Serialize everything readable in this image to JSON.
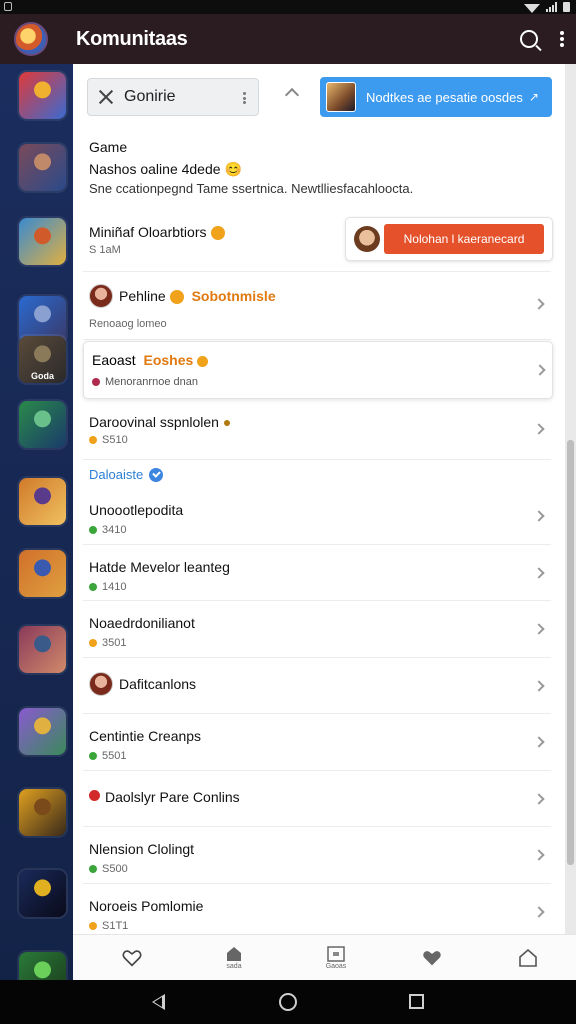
{
  "app": {
    "title": "Komunitaas"
  },
  "search": {
    "value": "Gonirie"
  },
  "promo": {
    "label": "Nodtkes ae pesatie oosdes",
    "arrow": "↗"
  },
  "intro": {
    "heading": "Game",
    "subheading": "Nashos oaline 4dede",
    "subheading_emoji": "😊",
    "description": "Sne ccationpegnd Tame ssertnica. Newtlliesfacahloocta."
  },
  "featured": {
    "title": "Miniñaf Oloarbtiors",
    "meta": "S 1aM",
    "button_label": "Nolohan l kaeranecard"
  },
  "rows": [
    {
      "title": "Pehline",
      "title_highlight": "Sobotnmisle",
      "meta": "Renoaog lomeo",
      "has_avatar": true
    },
    {
      "title": "Eaoast",
      "title_highlight": "Eoshes",
      "meta": "Menoranrnoe dnan",
      "card": true
    },
    {
      "title": "Daroovinal sspnlolen",
      "meta": "S510"
    }
  ],
  "section": {
    "label": "Daloaiste"
  },
  "list": [
    {
      "title": "Unoootlepodita",
      "meta": "3410",
      "dot_color": "#3aa63a"
    },
    {
      "title": "Hatde Mevelor leanteg",
      "meta": "1410",
      "dot_color": "#3aa63a"
    },
    {
      "title": "Noaedrdonilianot",
      "meta": "3501",
      "dot_color": "#f0a21a"
    },
    {
      "title": "Dafitcanlons",
      "meta": "",
      "has_avatar": true
    },
    {
      "title": "Centintie Creanps",
      "meta": "5501",
      "dot_color": "#3aa63a"
    },
    {
      "title": "Daolslyr Pare Conlins",
      "meta": "",
      "lead_dot": "#d22a2a"
    },
    {
      "title": "Nlension Clolingt",
      "meta": "S500",
      "dot_color": "#3aa63a"
    },
    {
      "title": "Noroeis Pomlomie",
      "meta": "S1T1",
      "dot_color": "#f0a21a"
    }
  ],
  "bottom_nav": [
    {
      "icon": "heart-outline-icon",
      "label": ""
    },
    {
      "icon": "shop-icon",
      "label": "sada"
    },
    {
      "icon": "gallery-icon",
      "label": "Gaoas"
    },
    {
      "icon": "heart-filled-icon",
      "label": ""
    },
    {
      "icon": "home-icon",
      "label": ""
    }
  ],
  "rail": [
    {
      "icon": "game-icon-1",
      "colors": [
        "#e03a3a",
        "#f0b030",
        "#3a6ad0"
      ]
    },
    {
      "icon": "game-icon-2",
      "colors": [
        "#7a4a5a",
        "#c08a6a",
        "#2a4a8a"
      ]
    },
    {
      "icon": "game-icon-3",
      "colors": [
        "#3a8ad0",
        "#d05a2a",
        "#e0b040"
      ]
    },
    {
      "icon": "game-icon-4",
      "colors": [
        "#2a6ad0",
        "#8aa0d0",
        "#3a3a6a"
      ]
    },
    {
      "icon": "game-icon-5",
      "colors": [
        "#5a4a3a",
        "#8a7a5a",
        "#2a2a2a"
      ],
      "label": "Goda"
    },
    {
      "icon": "game-icon-6",
      "colors": [
        "#2a8a4a",
        "#6ac08a",
        "#1a3a6a"
      ]
    },
    {
      "icon": "game-icon-7",
      "colors": [
        "#d07a2a",
        "#5a3a8a",
        "#f0c060"
      ]
    },
    {
      "icon": "game-icon-8",
      "colors": [
        "#d0702a",
        "#3a5ab0",
        "#e0a040"
      ]
    },
    {
      "icon": "game-icon-9",
      "colors": [
        "#8a3a5a",
        "#3a5a8a",
        "#d08a6a"
      ]
    },
    {
      "icon": "game-icon-10",
      "colors": [
        "#8a5ad0",
        "#e0b040",
        "#3a8a5a"
      ]
    },
    {
      "icon": "game-icon-11",
      "colors": [
        "#e0a020",
        "#7a4a1a",
        "#3a2a1a"
      ]
    },
    {
      "icon": "game-icon-12",
      "colors": [
        "#1a2a5a",
        "#e0b020",
        "#0a0a1a"
      ]
    },
    {
      "icon": "game-icon-13",
      "colors": [
        "#2a7a3a",
        "#6ad05a",
        "#1a3a1a"
      ]
    }
  ]
}
